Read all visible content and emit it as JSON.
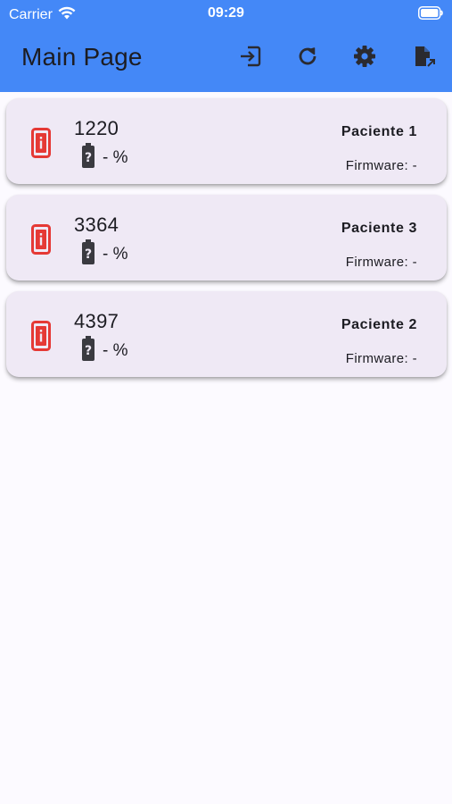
{
  "status_bar": {
    "carrier": "Carrier",
    "time": "09:29",
    "wifi_icon": "wifi-icon",
    "battery_icon": "battery-full-icon"
  },
  "app_bar": {
    "title": "Main Page",
    "background": "#4488f7",
    "actions": [
      {
        "icon": "login-icon"
      },
      {
        "icon": "refresh-icon"
      },
      {
        "icon": "settings-icon"
      },
      {
        "icon": "file-export-icon"
      }
    ]
  },
  "devices": [
    {
      "id": "1220",
      "battery": "- %",
      "patient": "Paciente 1",
      "firmware": "Firmware: -",
      "status_color": "#e53935"
    },
    {
      "id": "3364",
      "battery": "- %",
      "patient": "Paciente 3",
      "firmware": "Firmware: -",
      "status_color": "#e53935"
    },
    {
      "id": "4397",
      "battery": "- %",
      "patient": "Paciente 2",
      "firmware": "Firmware: -",
      "status_color": "#e53935"
    }
  ]
}
